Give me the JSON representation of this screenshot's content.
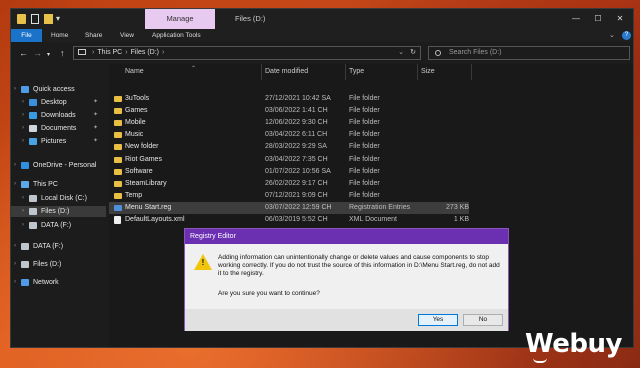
{
  "window": {
    "title": "Files (D:)",
    "manage_tab": "Manage",
    "controls": {
      "minimize": "—",
      "maximize": "☐",
      "close": "✕"
    }
  },
  "ribbon": {
    "tabs": [
      "File",
      "Home",
      "Share",
      "View",
      "Application Tools"
    ],
    "file_color": "#1a73c8"
  },
  "address": {
    "parts": [
      "This PC",
      "Files (D:)"
    ],
    "search_placeholder": "Search Files (D:)"
  },
  "nav": {
    "items": [
      {
        "label": "Quick access",
        "icon": "star-icon"
      },
      {
        "label": "Desktop",
        "icon": "desktop-folder-icon",
        "pinned": true
      },
      {
        "label": "Downloads",
        "icon": "downloads-folder-icon",
        "pinned": true
      },
      {
        "label": "Documents",
        "icon": "documents-folder-icon",
        "pinned": true
      },
      {
        "label": "Pictures",
        "icon": "pictures-folder-icon",
        "pinned": true
      },
      {
        "label": "OneDrive - Personal",
        "icon": "cloud-icon"
      },
      {
        "label": "This PC",
        "icon": "computer-icon"
      },
      {
        "label": "Local Disk (C:)",
        "icon": "drive-icon"
      },
      {
        "label": "Files (D:)",
        "icon": "drive-icon",
        "selected": true
      },
      {
        "label": "DATA (F:)",
        "icon": "drive-icon"
      },
      {
        "label": "DATA (F:)",
        "icon": "drive-icon"
      },
      {
        "label": "Files (D:)",
        "icon": "drive-icon"
      },
      {
        "label": "Network",
        "icon": "network-icon"
      }
    ],
    "pin_glyph": "✦",
    "chevron_glyph": "›"
  },
  "columns": {
    "name": "Name",
    "date": "Date modified",
    "type": "Type",
    "size": "Size"
  },
  "files": [
    {
      "name": "3uTools",
      "date": "27/12/2021 10:42 SA",
      "type": "File folder",
      "size": "",
      "icon": "folder-icon"
    },
    {
      "name": "Games",
      "date": "03/06/2022 1:41 CH",
      "type": "File folder",
      "size": "",
      "icon": "folder-icon"
    },
    {
      "name": "Mobile",
      "date": "12/06/2022 9:30 CH",
      "type": "File folder",
      "size": "",
      "icon": "folder-icon"
    },
    {
      "name": "Music",
      "date": "03/04/2022 6:11 CH",
      "type": "File folder",
      "size": "",
      "icon": "folder-icon"
    },
    {
      "name": "New folder",
      "date": "28/03/2022 9:29 SA",
      "type": "File folder",
      "size": "",
      "icon": "folder-icon"
    },
    {
      "name": "Riot Games",
      "date": "03/04/2022 7:35 CH",
      "type": "File folder",
      "size": "",
      "icon": "folder-icon"
    },
    {
      "name": "Software",
      "date": "01/07/2022 10:56 SA",
      "type": "File folder",
      "size": "",
      "icon": "folder-icon"
    },
    {
      "name": "SteamLibrary",
      "date": "26/02/2022 9:17 CH",
      "type": "File folder",
      "size": "",
      "icon": "folder-icon"
    },
    {
      "name": "Temp",
      "date": "07/12/2021 9:09 CH",
      "type": "File folder",
      "size": "",
      "icon": "folder-icon"
    },
    {
      "name": "Menu Start.reg",
      "date": "03/07/2022 12:59 CH",
      "type": "Registration Entries",
      "size": "273 KB",
      "icon": "registry-file-icon",
      "selected": true
    },
    {
      "name": "DefaultLayouts.xml",
      "date": "06/03/2019 5:52 CH",
      "type": "XML Document",
      "size": "1 KB",
      "icon": "xml-file-icon"
    }
  ],
  "dialog": {
    "title": "Registry Editor",
    "message": "Adding information can unintentionally change or delete values and cause components to stop working correctly. If you do not trust the source of this information in D:\\Menu Start.reg, do not add it to the registry.",
    "question": "Are you sure you want to continue?",
    "yes": "Yes",
    "no": "No",
    "title_color": "#6b2fb2",
    "warning_mark": "!"
  },
  "watermark": {
    "text": "Webuy"
  }
}
